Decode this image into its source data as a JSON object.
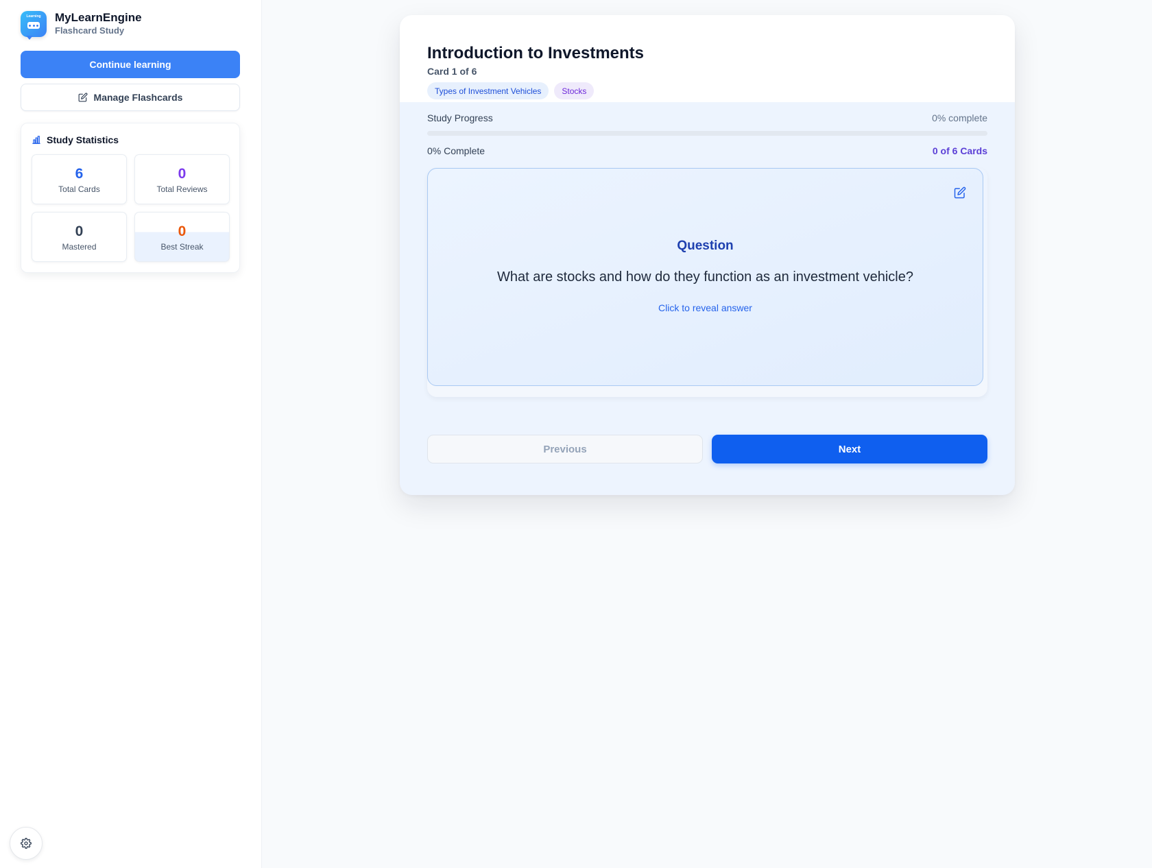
{
  "brand": {
    "logo_text": "Learning",
    "title": "MyLearnEngine",
    "subtitle": "Flashcard Study"
  },
  "sidebar": {
    "continue_label": "Continue learning",
    "manage_label": "Manage Flashcards",
    "manage_icon": "edit-icon",
    "stats": {
      "heading": "Study Statistics",
      "heading_icon": "bar-chart-icon",
      "items": [
        {
          "value": "6",
          "label": "Total Cards",
          "color": "#2563eb"
        },
        {
          "value": "0",
          "label": "Total Reviews",
          "color": "#7c3aed"
        },
        {
          "value": "0",
          "label": "Mastered",
          "color": "#334155"
        },
        {
          "value": "0",
          "label": "Best Streak",
          "color": "#ea580c"
        }
      ]
    },
    "settings_icon": "gear-icon"
  },
  "deck": {
    "title": "Introduction to Investments",
    "card_count": "Card 1 of 6",
    "tags": [
      "Types of Investment Vehicles",
      "Stocks"
    ]
  },
  "progress": {
    "label": "Study Progress",
    "percent_text": "0% complete",
    "complete_text": "0% Complete",
    "cards_text": "0 of 6 Cards",
    "fraction": 0
  },
  "card": {
    "side_label": "Question",
    "question": "What are stocks and how do they function as an investment vehicle?",
    "reveal_hint": "Click to reveal answer",
    "edit_icon": "edit-icon"
  },
  "nav": {
    "previous_label": "Previous",
    "next_label": "Next"
  },
  "colors": {
    "primary": "#3b82f6",
    "next_button": "#0f5fef",
    "accent_purple": "#5b3fd6"
  }
}
